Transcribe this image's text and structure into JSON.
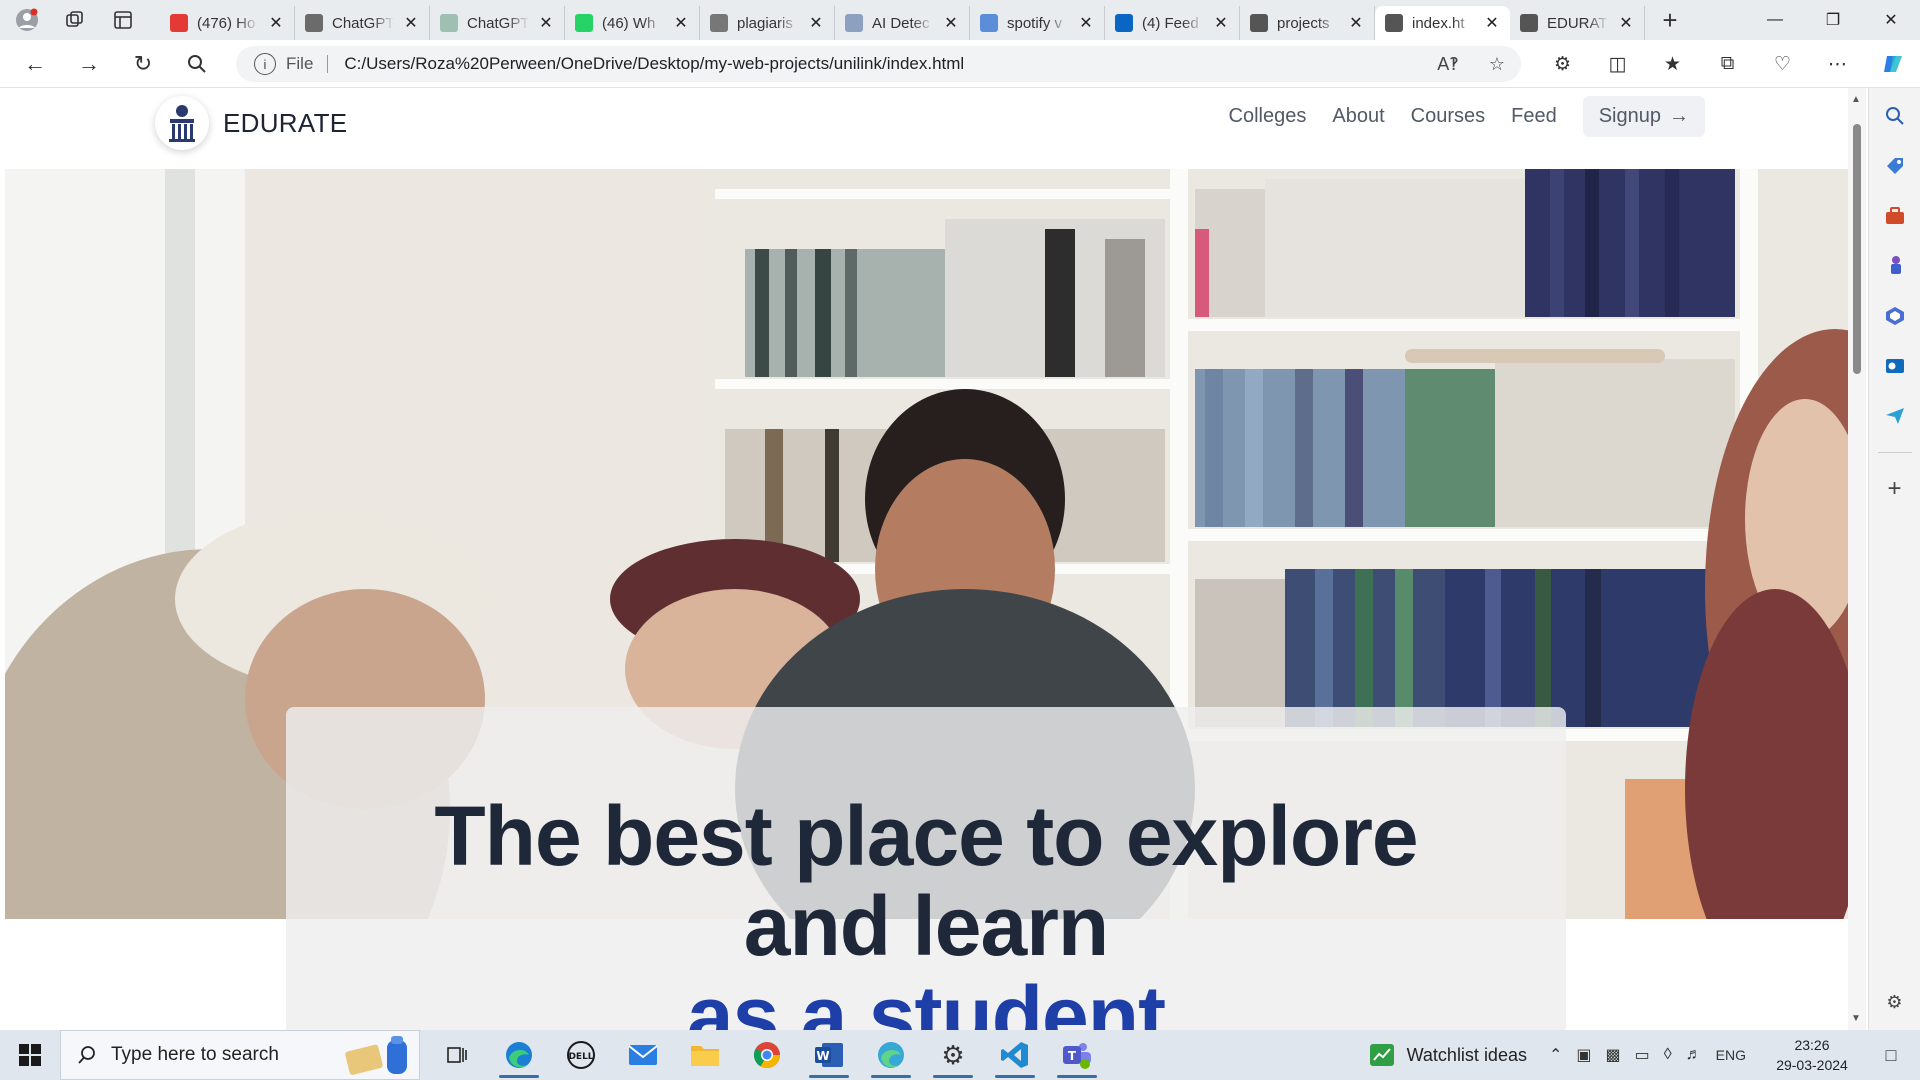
{
  "browser": {
    "tabs": [
      {
        "title": "(476) Ho",
        "favicon_color": "#e53935",
        "favicon": "youtube-icon"
      },
      {
        "title": "ChatGPT",
        "favicon_color": "#6b6b6b",
        "favicon": "openai-icon"
      },
      {
        "title": "ChatGPT",
        "favicon_color": "#9fbfb3",
        "favicon": "openai-icon"
      },
      {
        "title": "(46) Wh",
        "favicon_color": "#25d366",
        "favicon": "whatsapp-icon"
      },
      {
        "title": "plagiaris",
        "favicon_color": "#777777",
        "favicon": "link-icon"
      },
      {
        "title": "AI Detec",
        "favicon_color": "#8ea0c0",
        "favicon": "globe-icon"
      },
      {
        "title": "spotify v",
        "favicon_color": "#5b8dd9",
        "favicon": "search-icon"
      },
      {
        "title": "(4) Feed",
        "favicon_color": "#0a66c2",
        "favicon": "linkedin-icon"
      },
      {
        "title": "projects",
        "favicon_color": "#555555",
        "favicon": "file-icon"
      },
      {
        "title": "index.ht",
        "favicon_color": "#555555",
        "favicon": "file-icon",
        "active": true
      },
      {
        "title": "EDURAT",
        "favicon_color": "#555555",
        "favicon": "file-icon"
      }
    ],
    "address": {
      "scheme_label": "File",
      "url": "C:/Users/Roza%20Perween/OneDrive/Desktop/my-web-projects/unilink/index.html"
    }
  },
  "site": {
    "brand": "EDURATE",
    "nav": {
      "colleges": "Colleges",
      "about": "About",
      "courses": "Courses",
      "feed": "Feed",
      "signup": "Signup"
    },
    "hero": {
      "line1": "The best place to explore",
      "line2": "and learn",
      "accent": "as a student",
      "accent_color": "#1f3fa8"
    }
  },
  "taskbar": {
    "search_placeholder": "Type here to search",
    "widget": "Watchlist ideas",
    "language": "ENG",
    "time": "23:26",
    "date": "29-03-2024"
  }
}
